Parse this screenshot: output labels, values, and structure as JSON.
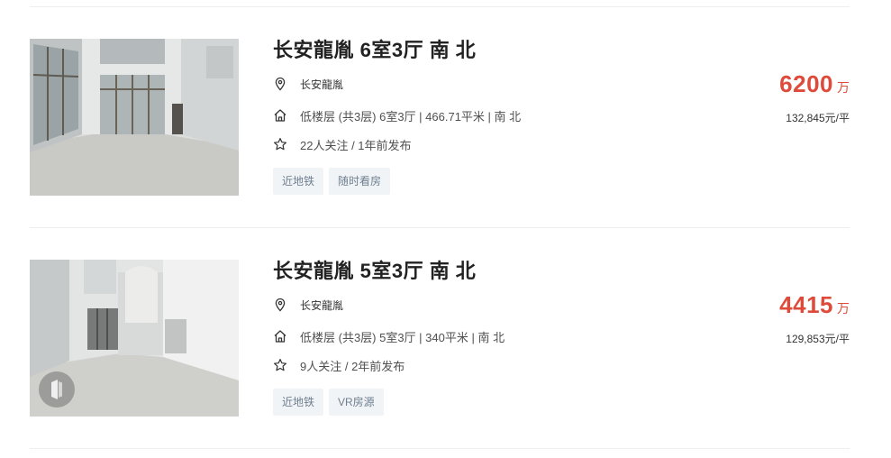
{
  "listings": [
    {
      "title": "长安龍胤 6室3厅 南 北",
      "community": "长安龍胤",
      "house_info": "低楼层 (共3层) 6室3厅 | 466.71平米 | 南 北",
      "follow_info": "22人关注 / 1年前发布",
      "tags": [
        "近地铁",
        "随时看房"
      ],
      "total_price": "6200",
      "price_unit": "万",
      "unit_price": "132,845元/平"
    },
    {
      "title": "长安龍胤 5室3厅 南 北",
      "community": "长安龍胤",
      "house_info": "低楼层 (共3层) 5室3厅 | 340平米 | 南 北",
      "follow_info": "9人关注 / 2年前发布",
      "tags": [
        "近地铁",
        "VR房源"
      ],
      "total_price": "4415",
      "price_unit": "万",
      "unit_price": "129,853元/平"
    }
  ],
  "icons": {
    "location": "map-pin-icon",
    "house": "house-icon",
    "follow": "star-outline-icon",
    "vr": "vr-badge-icon"
  },
  "colors": {
    "price": "#df4b3b",
    "tag_bg": "#f1f4f7",
    "tag_text": "#6f7f8f"
  }
}
